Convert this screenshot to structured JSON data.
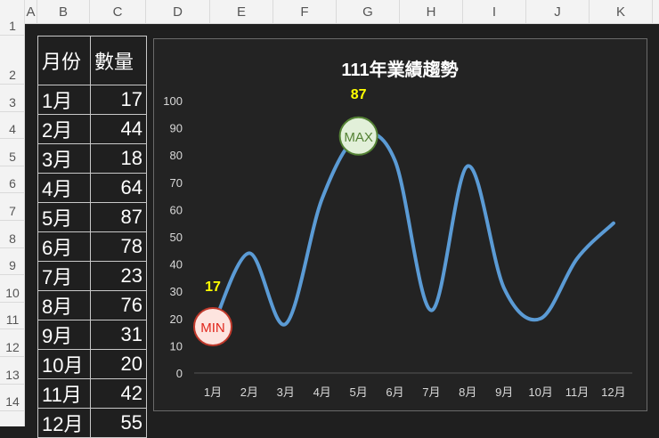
{
  "columns": [
    "A",
    "B",
    "C",
    "D",
    "E",
    "F",
    "G",
    "H",
    "I",
    "J",
    "K"
  ],
  "rows": [
    "1",
    "2",
    "3",
    "4",
    "5",
    "6",
    "7",
    "8",
    "9",
    "10",
    "11",
    "12",
    "13",
    "14"
  ],
  "table": {
    "headers": [
      "月份",
      "數量"
    ],
    "rows": [
      [
        "1月",
        "17"
      ],
      [
        "2月",
        "44"
      ],
      [
        "3月",
        "18"
      ],
      [
        "4月",
        "64"
      ],
      [
        "5月",
        "87"
      ],
      [
        "6月",
        "78"
      ],
      [
        "7月",
        "23"
      ],
      [
        "8月",
        "76"
      ],
      [
        "9月",
        "31"
      ],
      [
        "10月",
        "20"
      ],
      [
        "11月",
        "42"
      ],
      [
        "12月",
        "55"
      ]
    ]
  },
  "chart_data": {
    "type": "line",
    "title": "111年業績趨勢",
    "categories": [
      "1月",
      "2月",
      "3月",
      "4月",
      "5月",
      "6月",
      "7月",
      "8月",
      "9月",
      "10月",
      "11月",
      "12月"
    ],
    "values": [
      17,
      44,
      18,
      64,
      87,
      78,
      23,
      76,
      31,
      20,
      42,
      55
    ],
    "ylim": [
      0,
      100
    ],
    "yticks": [
      "0",
      "10",
      "20",
      "30",
      "40",
      "50",
      "60",
      "70",
      "80",
      "90",
      "100"
    ],
    "min_marker": {
      "label": "MIN",
      "value_label": "17"
    },
    "max_marker": {
      "label": "MAX",
      "value_label": "87"
    },
    "colors": {
      "line": "#5b9bd5",
      "label": "#ffff00",
      "min_fill": "#fde4df",
      "min_stroke": "#c0392b",
      "min_text": "#e0261b",
      "max_fill": "#e2f0d9",
      "max_stroke": "#548235",
      "max_text": "#548235"
    }
  }
}
